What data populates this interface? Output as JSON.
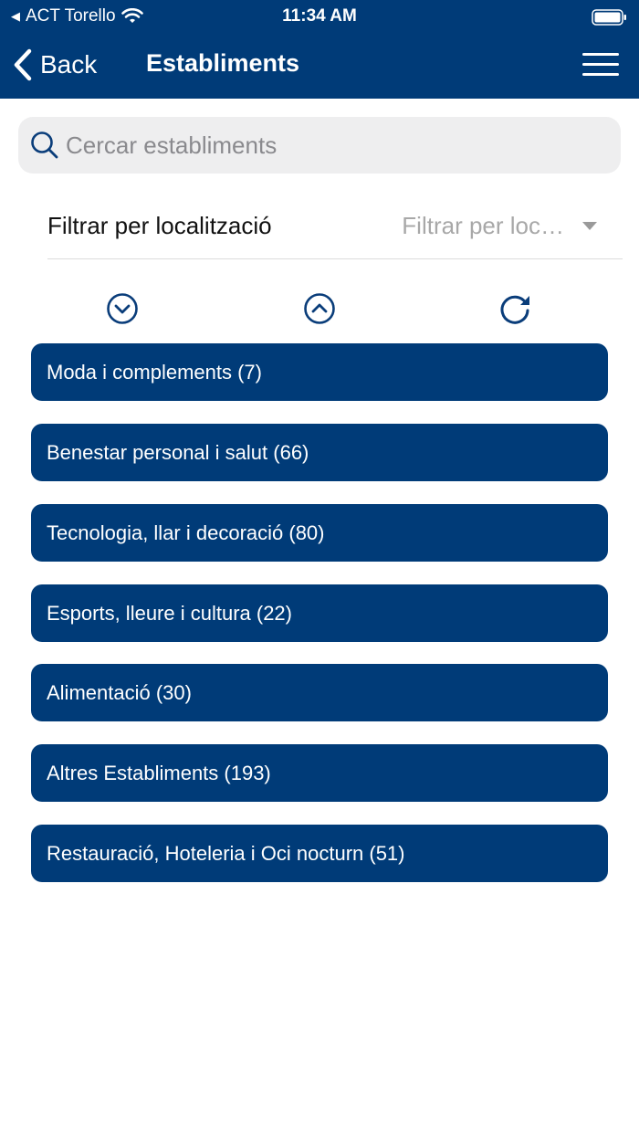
{
  "status": {
    "carrier": "ACT Torello",
    "time": "11:34 AM"
  },
  "nav": {
    "back_label": "Back",
    "title": "Establiments"
  },
  "search": {
    "placeholder": "Cercar establiments"
  },
  "filter": {
    "label": "Filtrar per localització",
    "select_value": "Filtrar per loc…"
  },
  "controls": {
    "expand_icon": "chevron-down-circle-icon",
    "collapse_icon": "chevron-up-circle-icon",
    "refresh_icon": "refresh-icon"
  },
  "categories": [
    {
      "label": "Moda i complements (7)"
    },
    {
      "label": "Benestar personal i salut (66)"
    },
    {
      "label": "Tecnologia, llar i decoració (80)"
    },
    {
      "label": "Esports, lleure i cultura (22)"
    },
    {
      "label": "Alimentació (30)"
    },
    {
      "label": "Altres Establiments (193)"
    },
    {
      "label": "Restauració, Hoteleria i Oci nocturn (51)"
    }
  ],
  "colors": {
    "brand": "#003b78",
    "accent_icon": "#0a3d7a"
  }
}
